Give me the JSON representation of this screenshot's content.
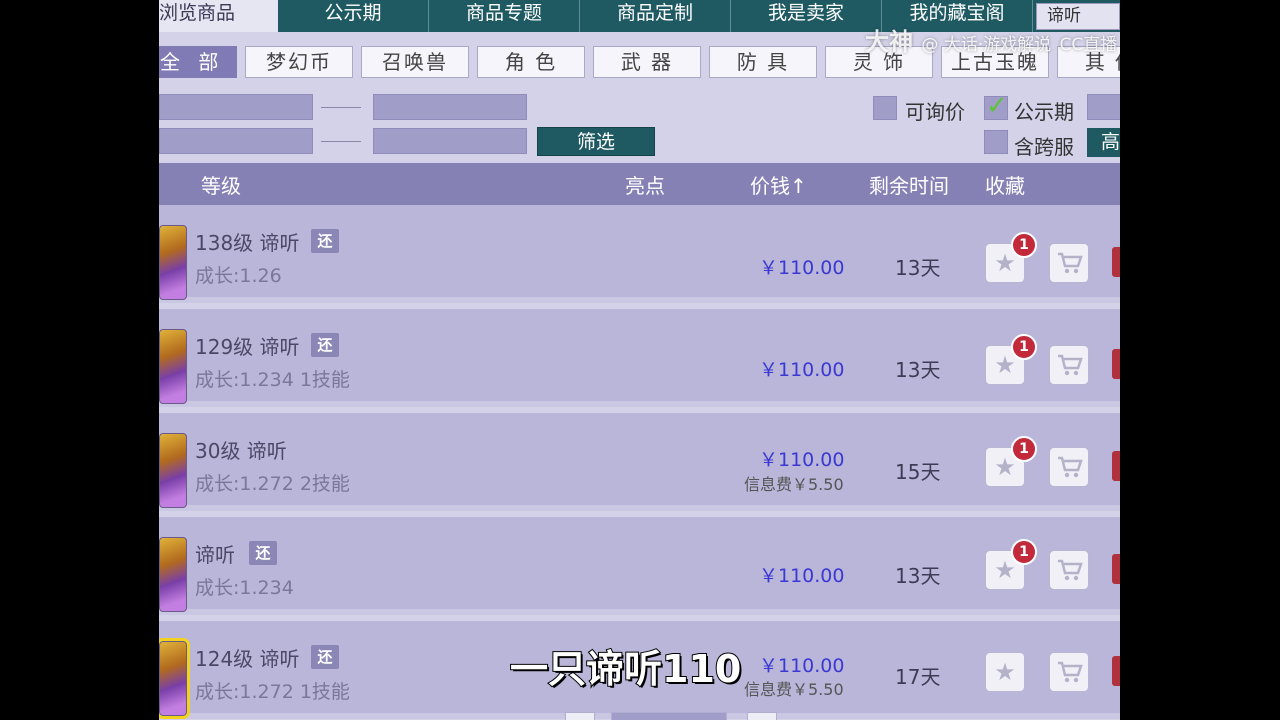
{
  "nav": {
    "tabs": [
      {
        "label": "浏览商品",
        "active": true
      },
      {
        "label": "公示期"
      },
      {
        "label": "商品专题"
      },
      {
        "label": "商品定制"
      },
      {
        "label": "我是卖家"
      },
      {
        "label": "我的藏宝阁"
      }
    ],
    "search_value": "谛听"
  },
  "categories": [
    "全 部",
    "梦幻币",
    "召唤兽",
    "角 色",
    "武 器",
    "防 具",
    "灵 饰",
    "上古玉魄",
    "其 他"
  ],
  "filters": {
    "button": "筛选",
    "checkbox_inquiry": "可询价",
    "checkbox_public": "公示期",
    "checkbox_cross": "含跨服",
    "advanced_button": "高"
  },
  "table": {
    "headers": {
      "level": "等级",
      "highlight": "亮点",
      "price": "价钱",
      "price_sort": "↑",
      "time_left": "剩余时间",
      "favorite": "收藏"
    },
    "rows": [
      {
        "level_name": "138级  谛听",
        "badge": "还",
        "growth": "成长:1.26",
        "price": "￥110.00",
        "fee": "",
        "time": "13天",
        "fav_count": "1"
      },
      {
        "level_name": "129级  谛听",
        "badge": "还",
        "growth": "成长:1.234  1技能",
        "price": "￥110.00",
        "fee": "",
        "time": "13天",
        "fav_count": "1"
      },
      {
        "level_name": "30级  谛听",
        "badge": "",
        "growth": "成长:1.272  2技能",
        "price": "￥110.00",
        "fee": "信息费￥5.50",
        "time": "15天",
        "fav_count": "1"
      },
      {
        "level_name": "谛听",
        "badge": "还",
        "growth": "成长:1.234",
        "price": "￥110.00",
        "fee": "",
        "time": "13天",
        "fav_count": "1"
      },
      {
        "level_name": "124级  谛听",
        "badge": "还",
        "growth": "成长:1.272  1技能",
        "price": "￥110.00",
        "fee": "信息费￥5.50",
        "time": "17天",
        "fav_count": ""
      }
    ]
  },
  "watermark": {
    "brand": "大神",
    "handle": "@ 大话·游戏解说",
    "platform": "CC直播"
  },
  "subtitle": "一只谛听110",
  "colors": {
    "nav_bg": "#1f5a63",
    "header_bg": "#8581b5",
    "row_bg": "#b9b6d9",
    "price": "#3c38d4",
    "badge_red": "#c22a3c"
  }
}
